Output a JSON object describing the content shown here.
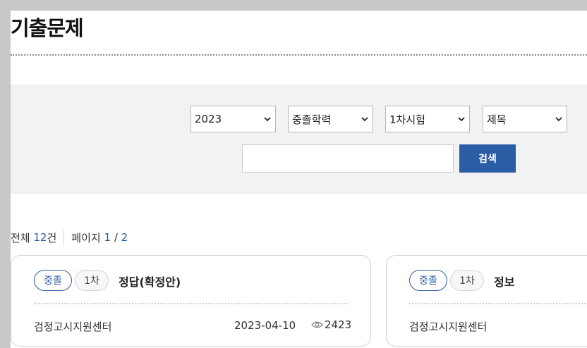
{
  "page": {
    "title": "기출문제"
  },
  "filters": {
    "year": "2023",
    "exam_type": "중졸학력",
    "round": "1차시험",
    "search_field": "제목",
    "search_placeholder": "",
    "search_button": "검색"
  },
  "summary": {
    "total_label": "전체",
    "total_count": "12",
    "total_unit": "건",
    "page_label": "페이지",
    "current_page": "1",
    "page_divider": "/",
    "total_pages": "2"
  },
  "posts": [
    {
      "badge_level": "중졸",
      "badge_round": "1차",
      "title": "정답(확정안)",
      "author": "검정고시지원센터",
      "date": "2023-04-10",
      "views": "2423"
    },
    {
      "badge_level": "중졸",
      "badge_round": "1차",
      "title": "정보",
      "author": "검정고시지원센터"
    }
  ],
  "icons": {
    "select_arrow": "chevron-down-icon",
    "views": "eye-icon"
  },
  "colors": {
    "accent": "#2b5da5",
    "panel": "#f1f2f4"
  }
}
